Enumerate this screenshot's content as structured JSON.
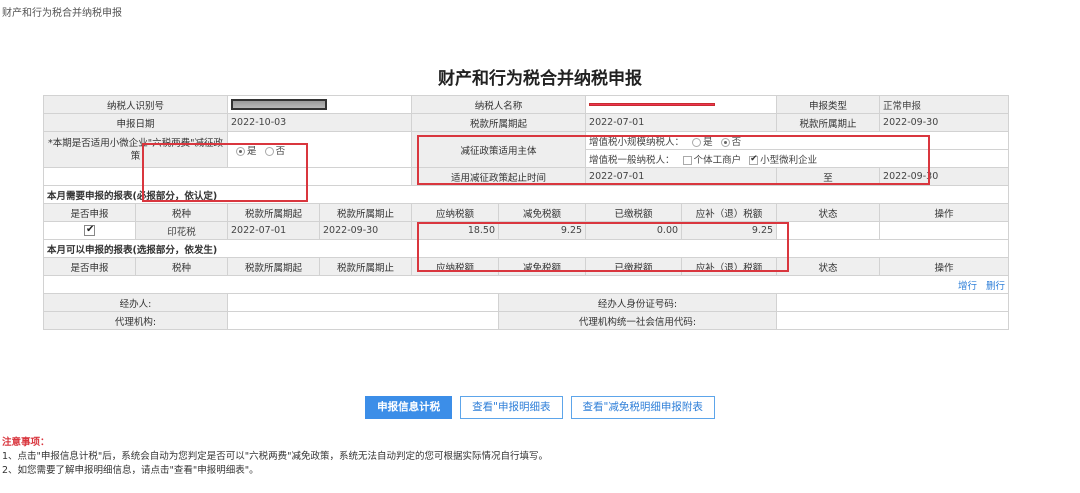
{
  "breadcrumb": "财产和行为税合并纳税申报",
  "title": "财产和行为税合并纳税申报",
  "info": {
    "taxpayer_id_label": "纳税人识别号",
    "taxpayer_name_label": "纳税人名称",
    "report_type_label": "申报类型",
    "report_type_value": "正常申报",
    "report_date_label": "申报日期",
    "report_date_value": "2022-10-03",
    "period_start_label": "税款所属期起",
    "period_start_value": "2022-07-01",
    "period_end_label": "税款所属期止",
    "period_end_value": "2022-09-30",
    "six_tax_question": "*本期是否适用小微企业\"六税两费\"减征政策",
    "yes": "是",
    "no": "否",
    "reduction_subject_label": "减征政策适用主体",
    "small_scale_label": "增值税小规模纳税人：",
    "general_label": "增值税一般纳税人：",
    "individual_business": "个体工商户",
    "small_micro": "小型微利企业",
    "reduction_start_label": "适用减征政策起止时间",
    "reduction_start_value": "2022-07-01",
    "to_label": "至",
    "reduction_end_value": "2022-09-30"
  },
  "required": {
    "section_title": "本月需要申报的报表(必报部分，依认定)",
    "headers": [
      "是否申报",
      "税种",
      "税款所属期起",
      "税款所属期止",
      "应纳税额",
      "减免税额",
      "已缴税额",
      "应补（退）税额",
      "状态",
      "操作"
    ],
    "row": {
      "tax": "印花税",
      "start": "2022-07-01",
      "end": "2022-09-30",
      "payable": "18.50",
      "reduced": "9.25",
      "paid": "0.00",
      "due": "9.25",
      "status": "",
      "action": ""
    }
  },
  "optional": {
    "section_title": "本月可以申报的报表(选报部分，依发生)",
    "headers": [
      "是否申报",
      "税种",
      "税款所属期起",
      "税款所属期止",
      "应纳税额",
      "减免税额",
      "已缴税额",
      "应补（退）税额",
      "状态",
      "操作"
    ],
    "add_row": "增行",
    "delete_row": "删行"
  },
  "agent": {
    "handler_label": "经办人:",
    "handler_id_label": "经办人身份证号码:",
    "agency_label": "代理机构:",
    "agency_code_label": "代理机构统一社会信用代码:"
  },
  "buttons": {
    "calc": "申报信息计税",
    "view_detail": "查看\"申报明细表",
    "view_reduction": "查看\"减免税明细申报附表"
  },
  "notes": {
    "title": "注意事项：",
    "line1": "1、点击\"申报信息计税\"后，系统会自动为您判定是否可以\"六税两费\"减免政策，系统无法自动判定的您可根据实际情况自行填写。",
    "line2": "2、如您需要了解申报明细信息，请点击\"查看\"申报明细表\"。"
  },
  "colors": {
    "highlight": "#d9363e",
    "primary": "#3c8ee8",
    "link": "#2f7fd8"
  }
}
